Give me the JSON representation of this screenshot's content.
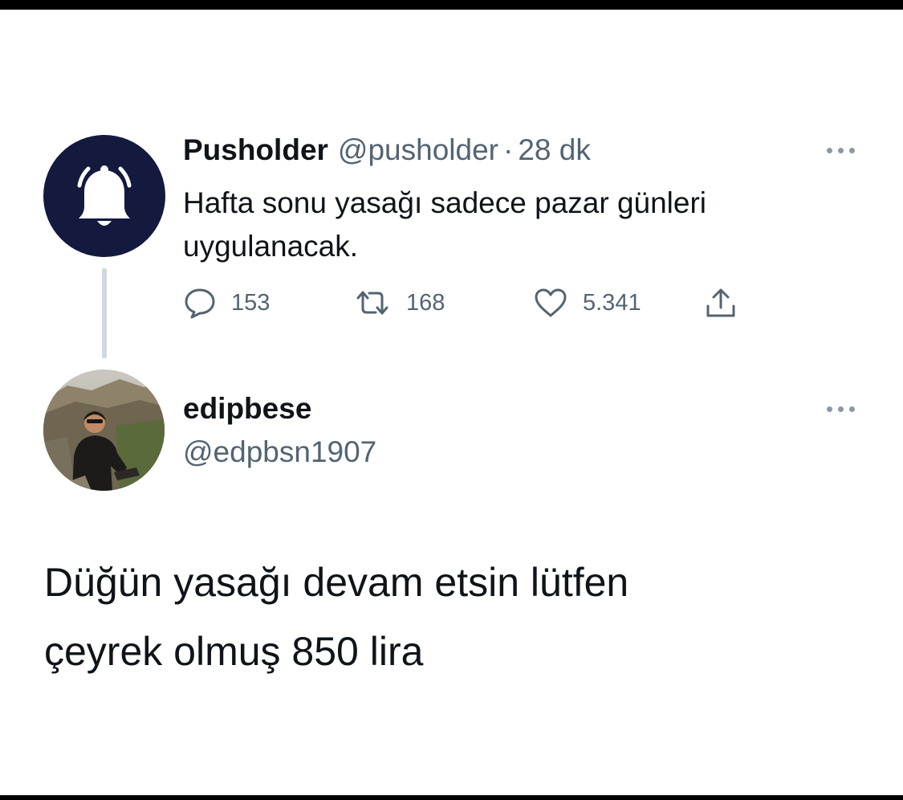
{
  "quoted_tweet": {
    "display_name": "Pusholder",
    "handle": "@pusholder",
    "separator": "·",
    "time": "28 dk",
    "text_line1": "Hafta sonu yasağı sadece pazar günleri",
    "text_line2": "uygulanacak.",
    "avatar_icon": "bell-icon",
    "avatar_color": "#131a3e",
    "replies": "153",
    "retweets": "168",
    "likes": "5.341"
  },
  "reply_tweet": {
    "display_name": "edipbese",
    "handle": "@edpbsn1907",
    "avatar": "profile-photo",
    "text_line1": "Düğün yasağı devam etsin lütfen",
    "text_line2": "çeyrek olmuş 850 lira"
  },
  "icons": {
    "reply": "speech-bubble-icon",
    "retweet": "retweet-arrows-icon",
    "like": "heart-icon",
    "share": "share-arrow-icon",
    "more": "ellipsis-icon"
  },
  "colors": {
    "text_primary": "#0f1419",
    "text_secondary": "#536471",
    "thread_line": "#cfd9de"
  }
}
